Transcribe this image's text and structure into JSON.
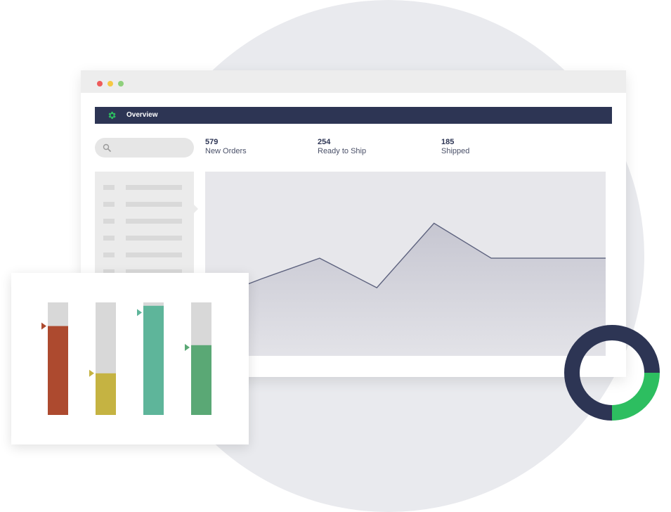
{
  "window": {
    "title": ""
  },
  "nav": {
    "title": "Overview",
    "icon": "gear-icon"
  },
  "search": {
    "placeholder": "",
    "icon": "search-icon"
  },
  "stats": [
    {
      "value": "579",
      "label": "New Orders"
    },
    {
      "value": "254",
      "label": "Ready to Ship"
    },
    {
      "value": "185",
      "label": "Shipped"
    }
  ],
  "sidebar": {
    "row_count": 6
  },
  "colors": {
    "nav": "#2d3554",
    "accent_green": "#2dbe60",
    "line": "#5d627e",
    "area_top": "#c9c9d3",
    "bar_red": "#ad4a2f",
    "bar_olive": "#c5b342",
    "bar_teal": "#5eb59a",
    "bar_green": "#5aa875",
    "bar_track": "#d8d8d8"
  },
  "chart_data": [
    {
      "type": "area",
      "x": [
        0,
        1,
        2,
        3,
        4,
        5,
        6,
        7
      ],
      "values": [
        20,
        42,
        53,
        37,
        72,
        53,
        53,
        53
      ],
      "ylim": [
        0,
        100
      ]
    },
    {
      "type": "bar",
      "categories": [
        "",
        "",
        "",
        ""
      ],
      "values": [
        79,
        37,
        97,
        62
      ],
      "markers": [
        79,
        37,
        91,
        60
      ],
      "ylim": [
        0,
        100
      ]
    },
    {
      "type": "pie",
      "values": [
        75,
        25
      ],
      "colors": [
        "#2d3554",
        "#2dbe60"
      ]
    }
  ]
}
